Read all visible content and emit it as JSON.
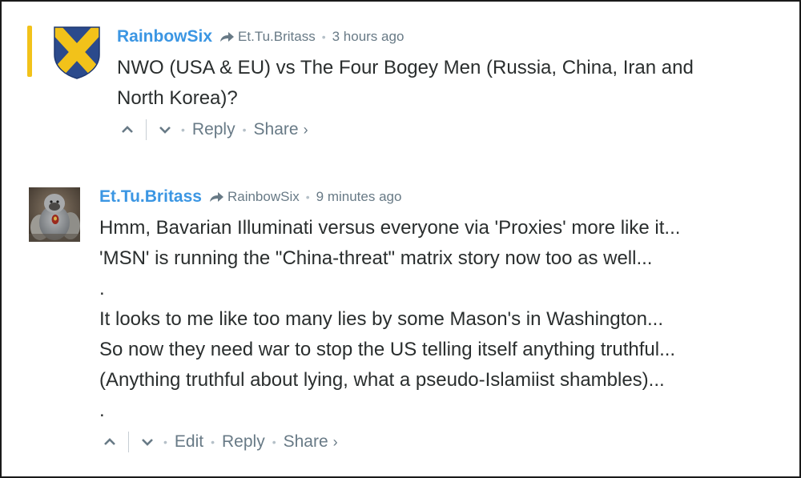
{
  "comments": [
    {
      "author": "RainbowSix",
      "reply_to": "Et.Tu.Britass",
      "time": "3 hours ago",
      "lines": [
        "NWO (USA & EU) vs The Four Bogey Men (Russia, China, Iran and",
        "North Korea)?"
      ],
      "actions": {
        "reply": "Reply",
        "share": "Share",
        "share_chevron": "›"
      },
      "avatar_icon": "shield-cross-icon",
      "highlight_color": "#f2c21a"
    },
    {
      "author": "Et.Tu.Britass",
      "reply_to": "RainbowSix",
      "time": "9 minutes ago",
      "lines": [
        "Hmm, Bavarian Illuminati versus everyone via 'Proxies' more like it...",
        "'MSN' is running the \"China-threat\" matrix story now too as well...",
        ".",
        "It looks to me like too many lies by some Mason's in Washington...",
        "So now they need war to stop the US telling itself anything truthful...",
        "(Anything truthful about lying, what a pseudo-Islamiist shambles)...",
        "."
      ],
      "actions": {
        "edit": "Edit",
        "reply": "Reply",
        "share": "Share",
        "share_chevron": "›"
      },
      "avatar_icon": "gorilla-photo-avatar"
    }
  ],
  "colors": {
    "author_link": "#3b96e3",
    "meta_text": "#687a86",
    "body_text": "#2a2e2e",
    "shield_blue": "#2b4a8c",
    "shield_gold": "#f2c21a"
  }
}
